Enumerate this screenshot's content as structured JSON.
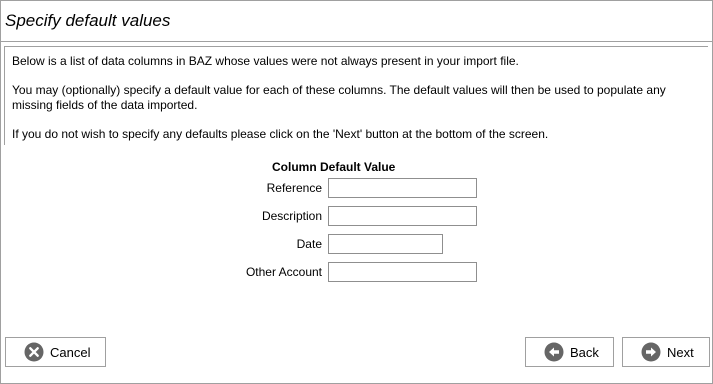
{
  "header": {
    "title": "Specify default values"
  },
  "info": {
    "line1": "Below is a list of data columns in BAZ whose values were not always present in your import file.",
    "line2": "You may (optionally) specify a default value for each of these columns. The default values will then be used to populate any missing fields of the data imported.",
    "line3": "If you do not wish to specify any defaults please click on the 'Next' button at the bottom of the screen."
  },
  "form": {
    "column_header": "Column Default Value",
    "fields": [
      {
        "label": "Reference",
        "value": ""
      },
      {
        "label": "Description",
        "value": ""
      },
      {
        "label": "Date",
        "value": ""
      },
      {
        "label": "Other Account",
        "value": ""
      }
    ]
  },
  "buttons": {
    "cancel": "Cancel",
    "back": "Back",
    "next": "Next"
  },
  "icons": {
    "cancel": "cancel-icon",
    "back": "arrow-left-icon",
    "next": "arrow-right-icon"
  },
  "colors": {
    "icon_fill": "#666666",
    "border": "#a0a0a0"
  }
}
